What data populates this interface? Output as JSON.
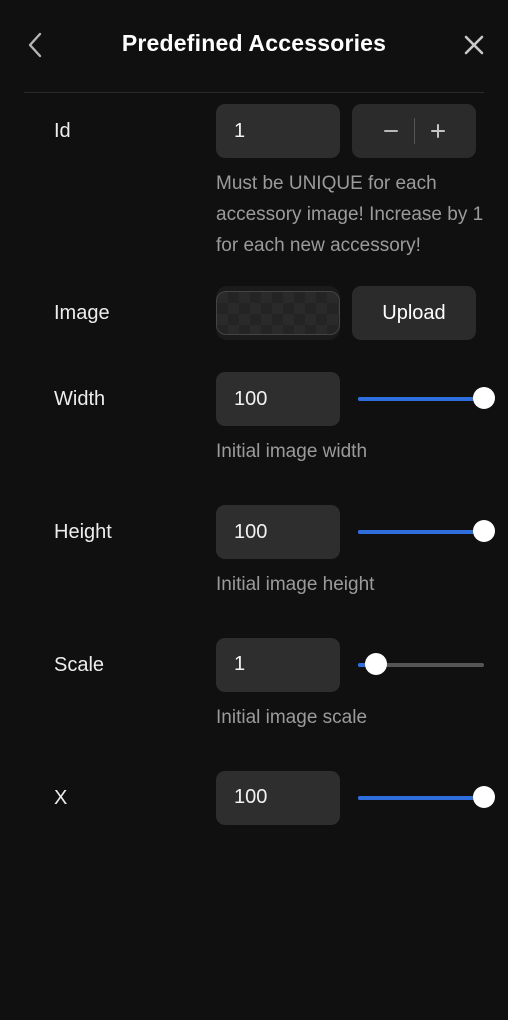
{
  "header": {
    "title": "Predefined Accessories",
    "back_icon": "chevron-left-icon",
    "close_icon": "close-icon"
  },
  "fields": {
    "id": {
      "label": "Id",
      "value": "1",
      "placeholder": "",
      "helper": "Must be UNIQUE for each accessory image! Increase by 1 for each new accessory!",
      "stepper": {
        "decrement_label": "−",
        "increment_label": "+"
      }
    },
    "image": {
      "label": "Image",
      "thumbnail": "checkerboard-transparent-thumbnail",
      "upload_label": "Upload"
    },
    "width": {
      "label": "Width",
      "value": "100",
      "helper": "Initial image width",
      "slider": {
        "percent": 100
      }
    },
    "height": {
      "label": "Height",
      "value": "100",
      "helper": "Initial image height",
      "slider": {
        "percent": 100
      }
    },
    "scale": {
      "label": "Scale",
      "value": "1",
      "helper": "Initial image scale",
      "slider": {
        "percent": 14
      }
    },
    "x": {
      "label": "X",
      "value": "100",
      "slider": {
        "percent": 100
      }
    }
  },
  "colors": {
    "background": "#101010",
    "panel": "#2b2b2b",
    "input": "#2e2e2e",
    "accent": "#2f6fdd",
    "label": "#ededed",
    "helper": "#9b9b9b",
    "divider": "#2a2a2a"
  }
}
